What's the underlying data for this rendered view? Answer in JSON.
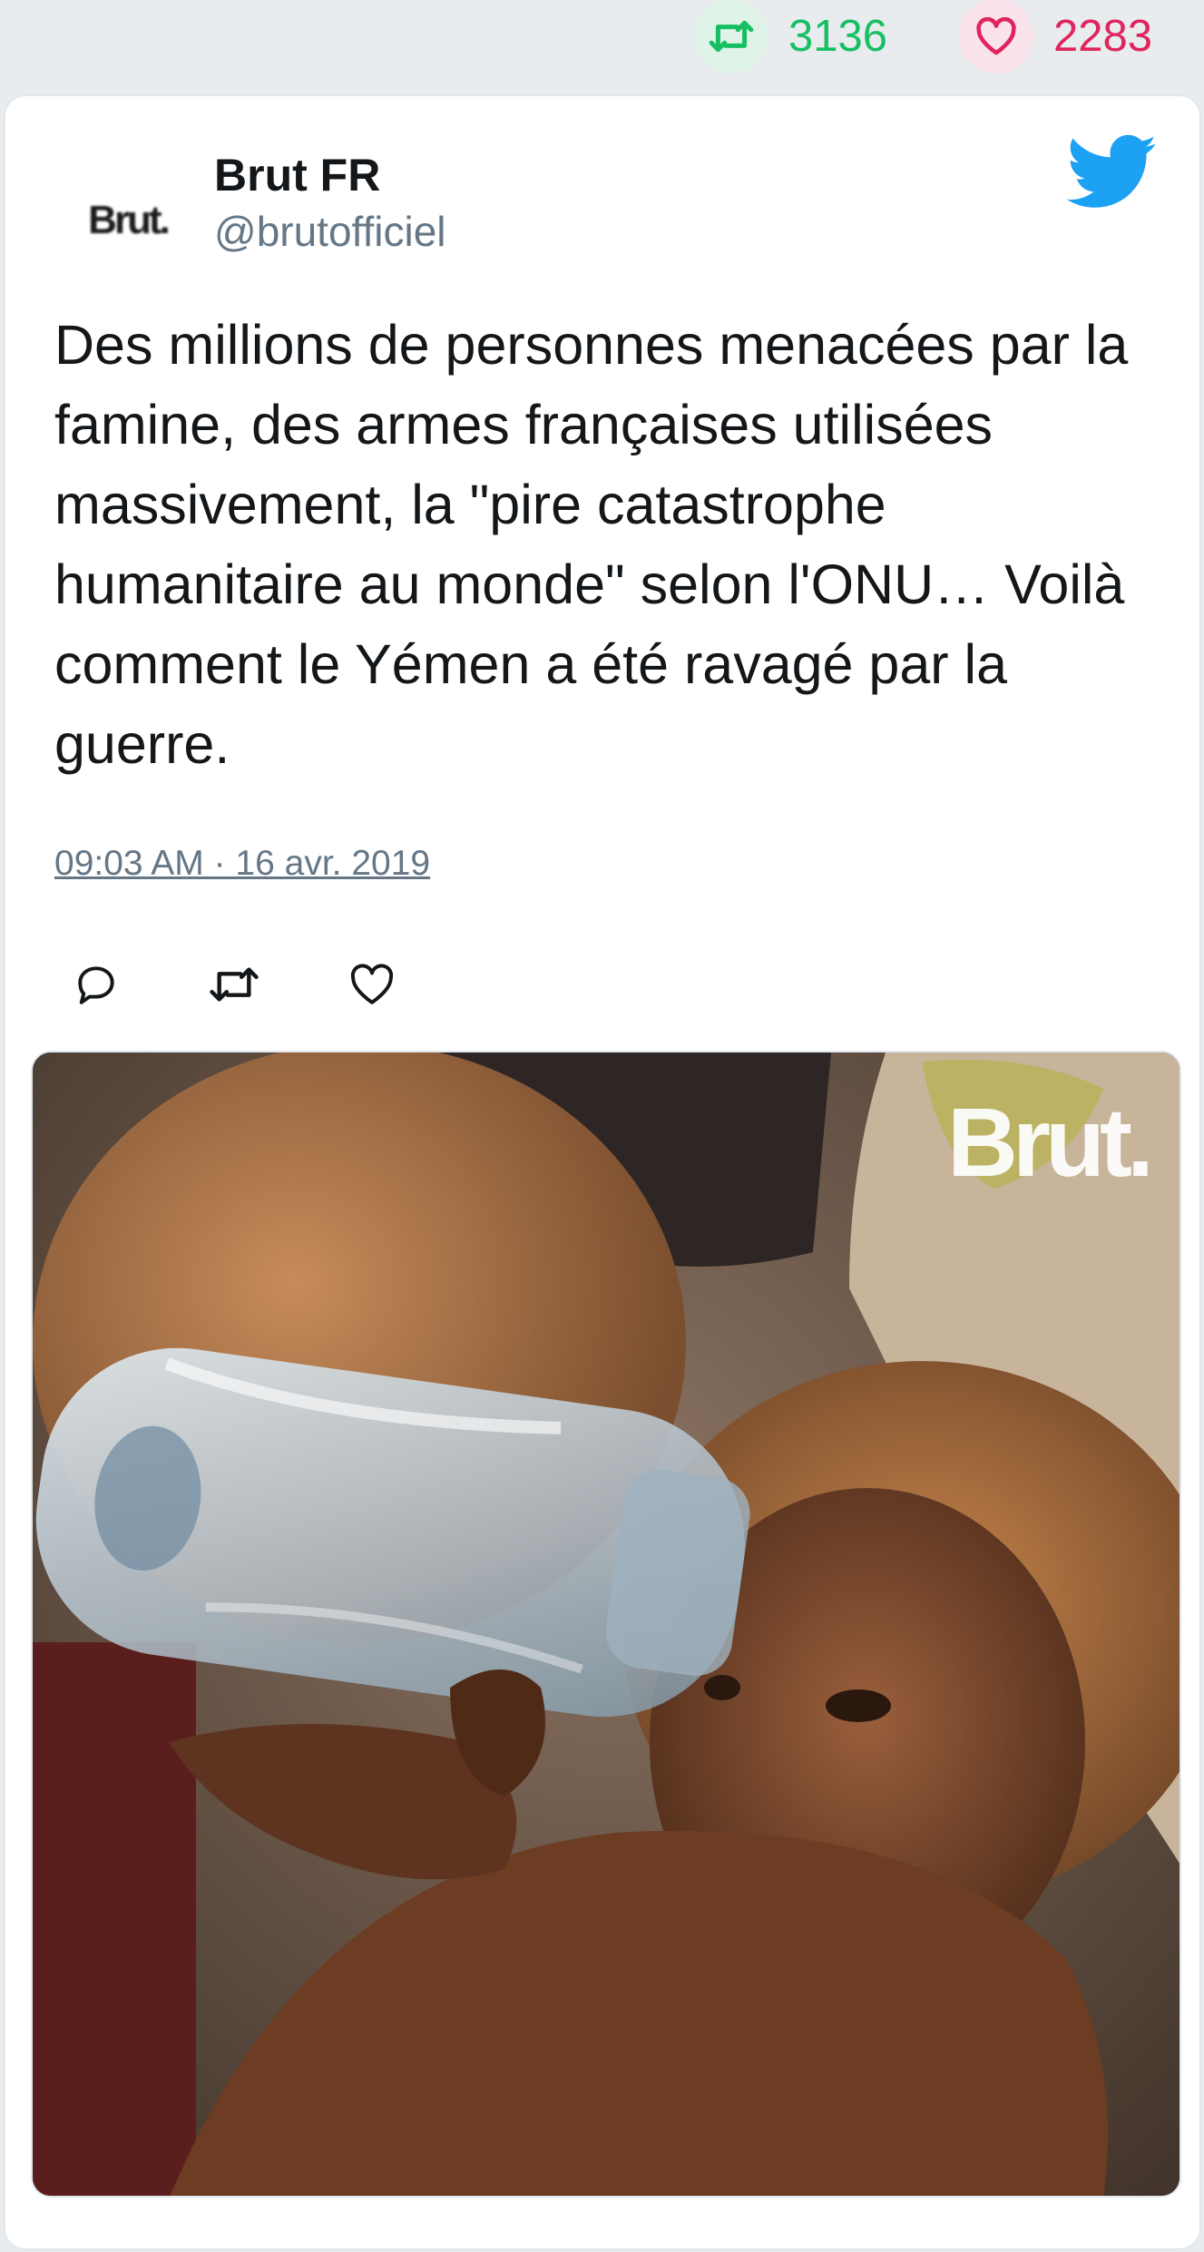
{
  "stats": {
    "retweet_icon": "retweet-icon",
    "retweet_count": "3136",
    "like_icon": "heart-icon",
    "like_count": "2283",
    "retweet_color": "#17bf63",
    "like_color": "#e0245e"
  },
  "tweet": {
    "avatar_text": "Brut.",
    "author_name": "Brut FR",
    "author_handle": "@brutofficiel",
    "brand_icon": "twitter-bird-icon",
    "brand_color": "#1da1f2",
    "text": "Des millions de personnes menacées par la famine, des armes françaises utilisées massivement, la \"pire catastrophe humanitaire au monde\" selon l'ONU… Voilà comment le Yémen a été ravagé par la guerre.",
    "timestamp": "09:03 AM · 16 avr. 2019",
    "actions": [
      "reply-icon",
      "retweet-icon",
      "heart-icon"
    ],
    "media": {
      "watermark": "Brut."
    }
  }
}
